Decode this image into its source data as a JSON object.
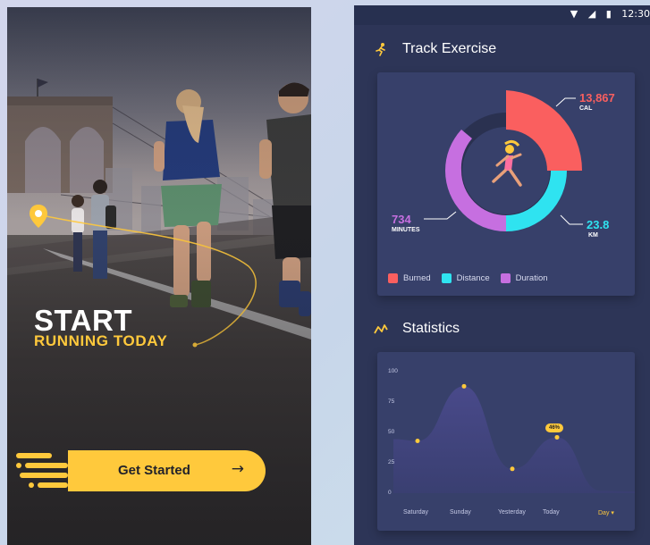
{
  "onboarding": {
    "title": "START",
    "subtitle": "RUNNING TODAY",
    "cta_label": "Get Started",
    "cta_icon": "arrow-right-icon",
    "accent": "#ffc93c"
  },
  "status_bar": {
    "time": "12:30",
    "icons": [
      "wifi-icon",
      "signal-icon",
      "battery-icon"
    ]
  },
  "track": {
    "title": "Track Exercise",
    "icon": "runner-icon",
    "calories": {
      "value": "13,867",
      "unit": "CAL",
      "color": "#fa5f5f"
    },
    "distance": {
      "value": "23.8",
      "unit": "KM",
      "color": "#2fe3f0"
    },
    "duration": {
      "value": "734",
      "unit": "MINUTES",
      "color": "#c66fe0"
    },
    "legend": [
      {
        "label": "Burned",
        "color": "#fa5f5f"
      },
      {
        "label": "Distance",
        "color": "#2fe3f0"
      },
      {
        "label": "Duration",
        "color": "#c66fe0"
      }
    ]
  },
  "statistics": {
    "title": "Statistics",
    "icon": "trend-icon",
    "badge": "46%",
    "period_select": "Day"
  },
  "chart_data": {
    "type": "area",
    "categories": [
      "Saturday",
      "Sunday",
      "Yesterday",
      "Today"
    ],
    "values": [
      43,
      88,
      20,
      46
    ],
    "y_ticks": [
      "100",
      "75",
      "50",
      "25",
      "0"
    ],
    "ylim": [
      0,
      100
    ],
    "grid": false,
    "fill_color": "#4a4a8c",
    "point_color": "#ffc93c"
  }
}
